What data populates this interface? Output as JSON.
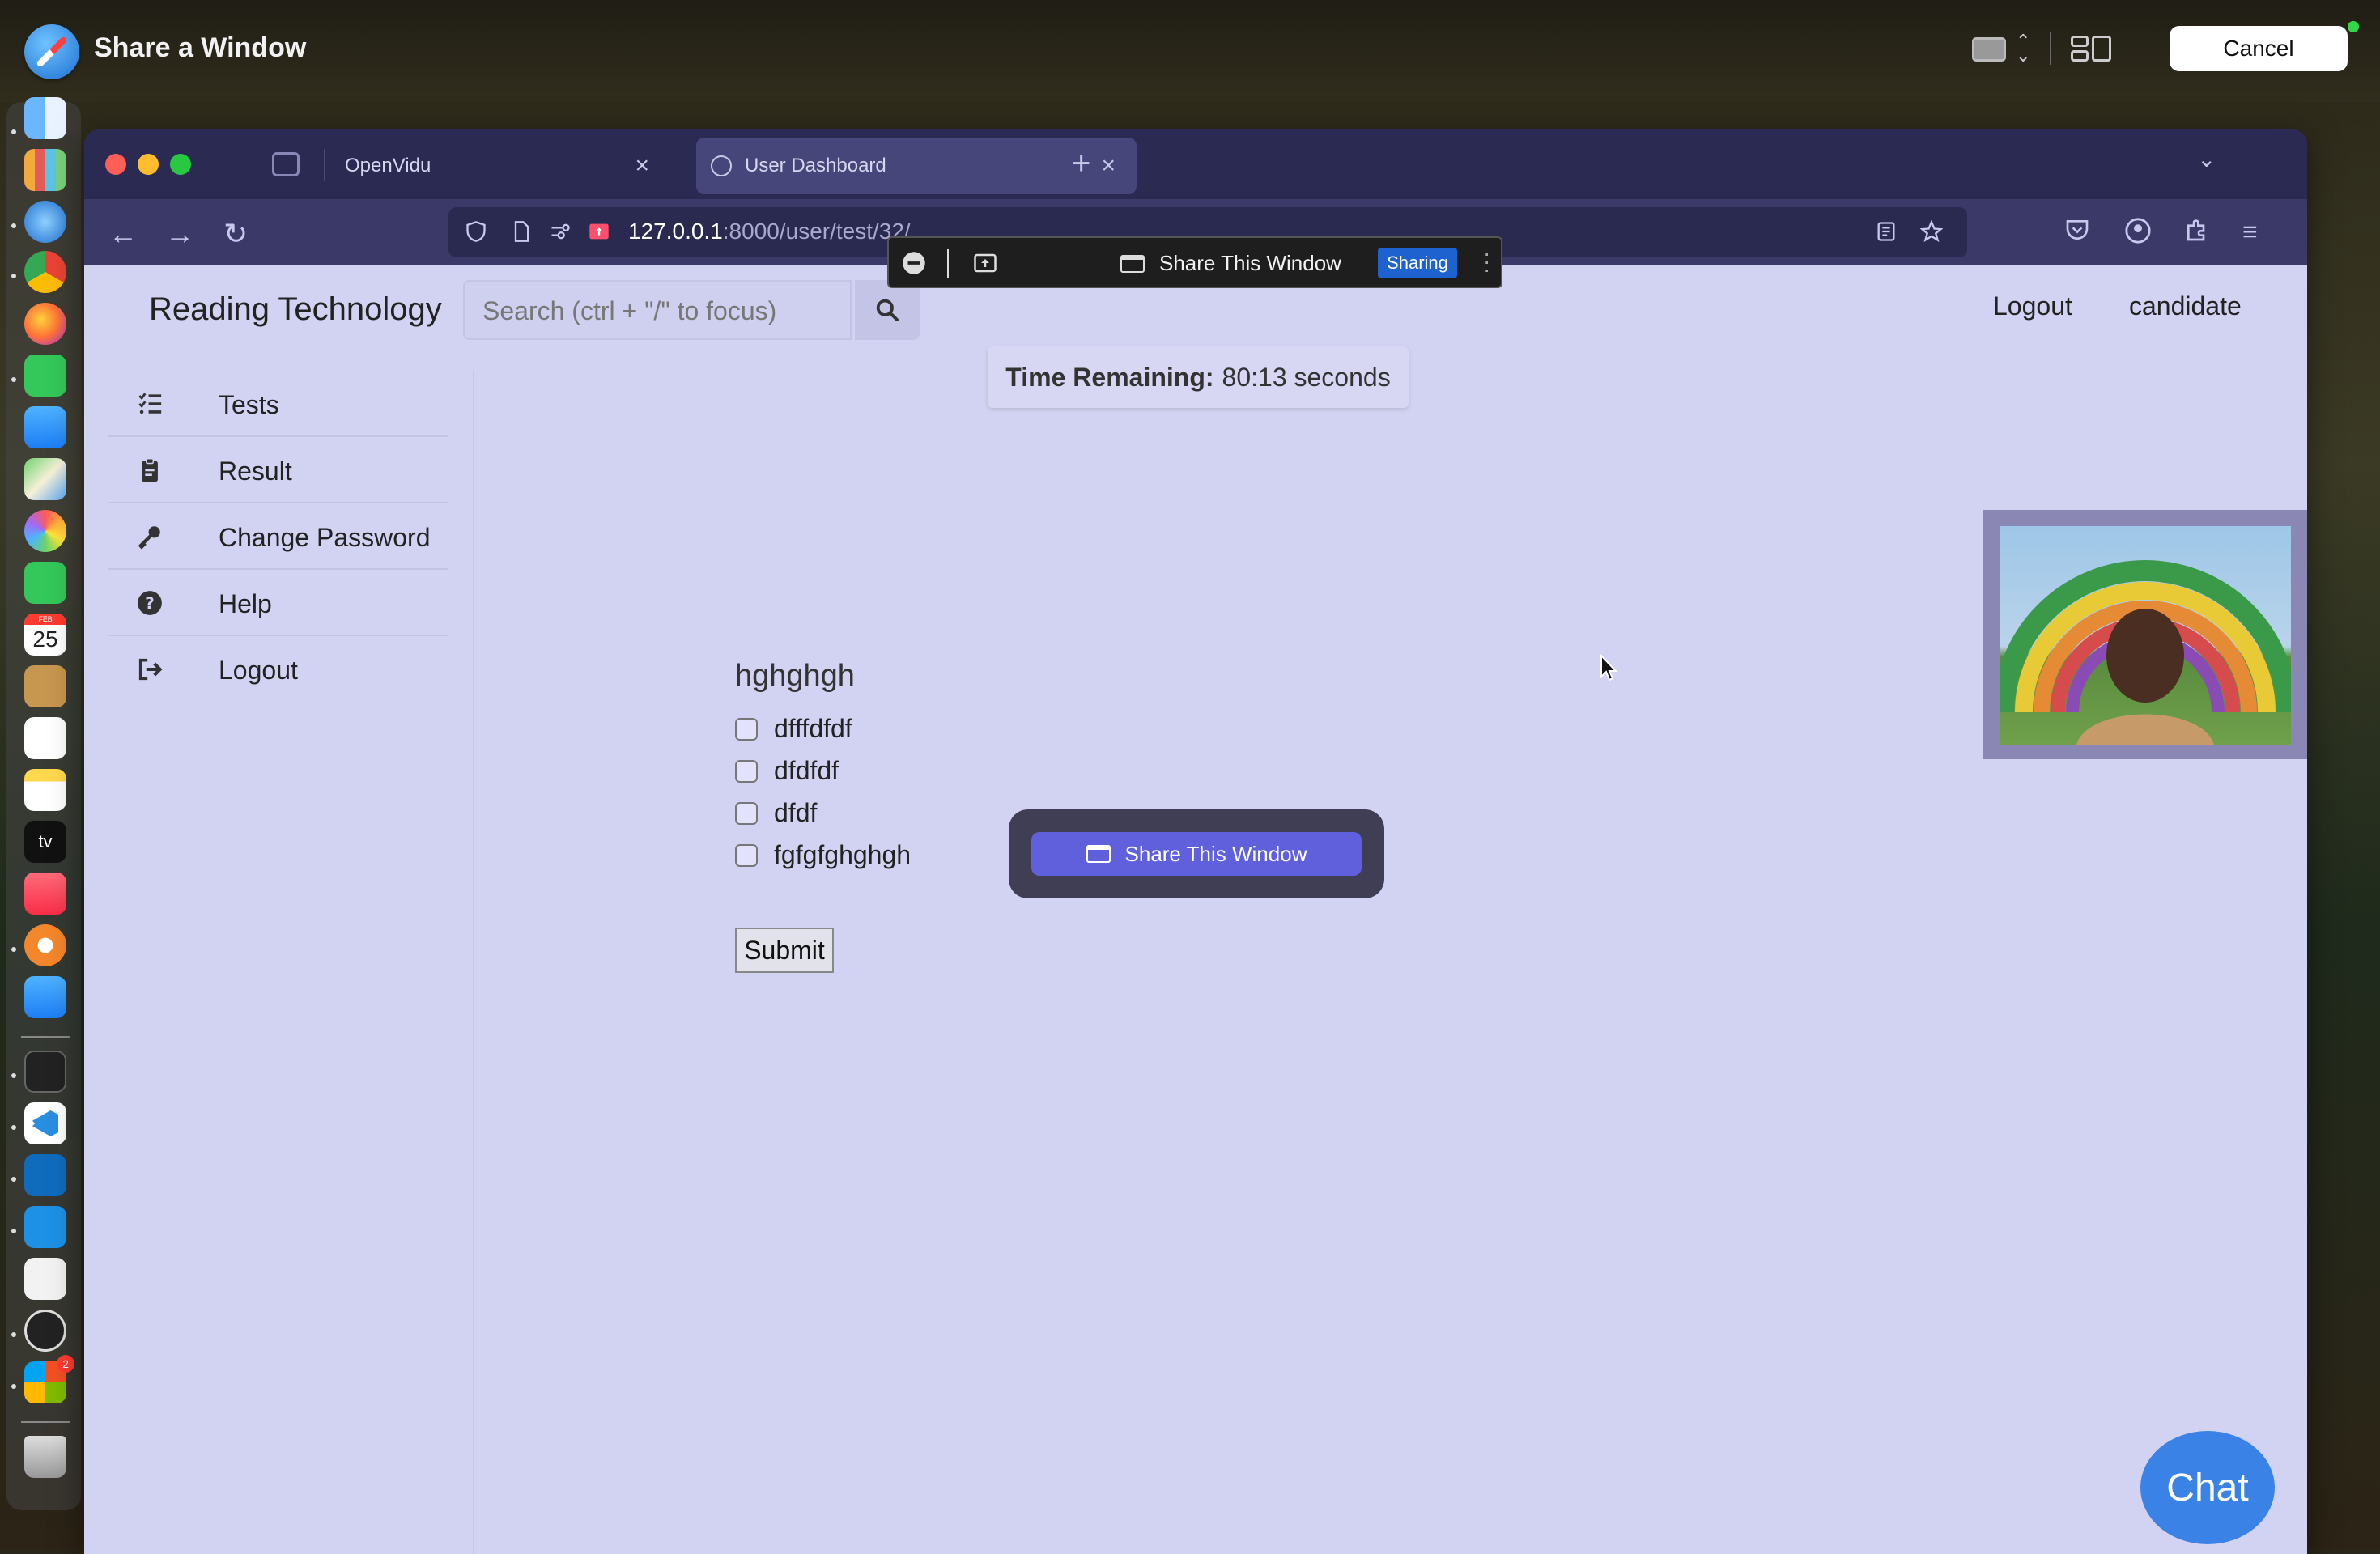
{
  "share_bar": {
    "title": "Share a Window",
    "cancel_label": "Cancel"
  },
  "dock": {
    "items": [
      "finder-icon",
      "launchpad-icon",
      "safari-icon",
      "chrome-icon",
      "firefox-icon",
      "messages-icon",
      "mail-icon",
      "maps-icon",
      "photos-icon",
      "facetime-icon",
      "calendar-icon",
      "contacts-icon",
      "reminders-icon",
      "notes-icon",
      "apple-tv-icon",
      "music-icon",
      "chrome-beta-icon",
      "app-store-icon",
      "terminal-icon",
      "vscode-icon",
      "outlook-icon",
      "docker-icon",
      "textedit-icon",
      "obs-icon",
      "office-icon",
      "trash-icon"
    ],
    "calendar_day": "25",
    "calendar_month": "FEB",
    "badge_count": "2",
    "apple_tv_label": "tv"
  },
  "browser": {
    "tabs": [
      {
        "label": "OpenVidu",
        "active": false
      },
      {
        "label": "User Dashboard",
        "active": true
      }
    ],
    "url_host": "127.0.0.1",
    "url_path": ":8000/user/test/32/"
  },
  "share_toolbar": {
    "label": "Share This Window",
    "status": "Sharing"
  },
  "page": {
    "brand": "Reading Technology",
    "search_placeholder": "Search (ctrl + \"/\" to focus)",
    "top_links": {
      "logout": "Logout",
      "user": "candidate"
    },
    "sidebar": [
      {
        "label": "Tests",
        "icon": "list-check-icon"
      },
      {
        "label": "Result",
        "icon": "clipboard-icon"
      },
      {
        "label": "Change Password",
        "icon": "key-icon"
      },
      {
        "label": "Help",
        "icon": "question-circle-icon"
      },
      {
        "label": "Logout",
        "icon": "sign-out-icon"
      }
    ],
    "timer": {
      "label": "Time Remaining:",
      "value": "80:13 seconds"
    },
    "question": {
      "title": "hghghgh",
      "options": [
        "dfffdfdf",
        "dfdfdf",
        "dfdf",
        "fgfgfghghgh"
      ]
    },
    "submit_label": "Submit",
    "chat_label": "Chat"
  },
  "share_modal": {
    "button_label": "Share This Window"
  },
  "colors": {
    "page_bg": "#d2d2f2",
    "browser_chrome": "#3a3968",
    "accent": "#6160dc",
    "chat": "#3b82e6",
    "sharing_badge": "#1e62d0"
  }
}
